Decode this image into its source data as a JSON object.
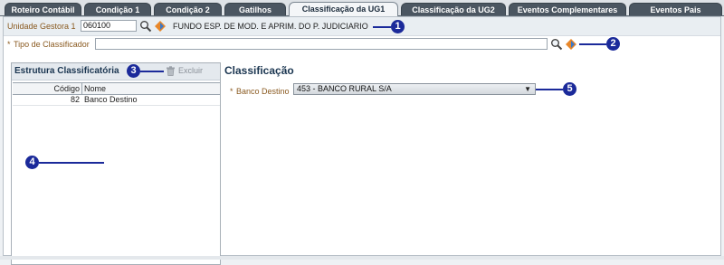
{
  "tabs": [
    {
      "label": "Roteiro Contábil",
      "active": false
    },
    {
      "label": "Condição 1",
      "active": false
    },
    {
      "label": "Condição 2",
      "active": false
    },
    {
      "label": "Gatilhos",
      "active": false
    },
    {
      "label": "Classificação da UG1",
      "active": true
    },
    {
      "label": "Classificação da UG2",
      "active": false
    },
    {
      "label": "Eventos Complementares",
      "active": false
    },
    {
      "label": "Eventos Pais",
      "active": false
    }
  ],
  "unidade_gestora": {
    "label": "Unidade Gestora 1",
    "value": "060100",
    "description": "FUNDO ESP. DE MOD. E APRIM. DO P. JUDICIARIO"
  },
  "tipo_classificador": {
    "required_mark": "*",
    "label": "Tipo de Classificador",
    "value": ""
  },
  "estrutura": {
    "title": "Estrutura Classificatória",
    "delete_label": "Excluir",
    "columns": [
      "Código",
      "Nome"
    ],
    "rows": [
      {
        "codigo": "82",
        "nome": "Banco Destino"
      }
    ]
  },
  "classificacao": {
    "title": "Classificação",
    "field_required_mark": "*",
    "field_label": "Banco Destino",
    "selected_value": "453 - BANCO RURAL S/A"
  },
  "markers": [
    "1",
    "2",
    "3",
    "4",
    "5"
  ],
  "colors": {
    "tab_dark": "#4b5661",
    "marker_blue": "#1b2a9a",
    "label_brown": "#8a5a20",
    "title_navy": "#1a3550"
  },
  "icons": {
    "search": "magnifier-icon",
    "lookup": "diamond-lookup-icon",
    "trash": "trash-icon",
    "dropdown": "chevron-down-icon"
  }
}
